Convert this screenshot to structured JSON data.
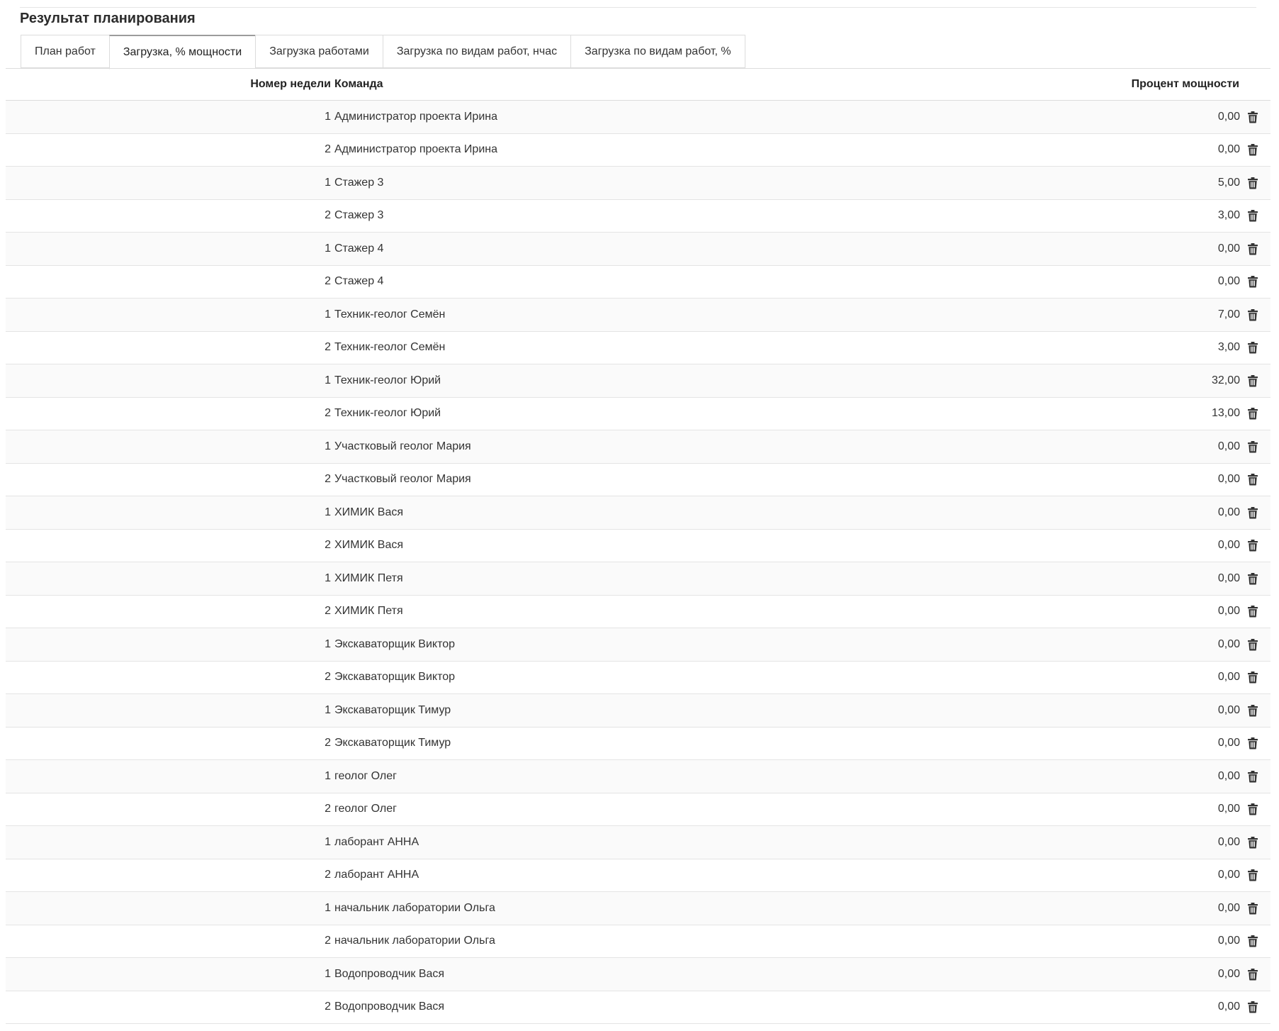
{
  "section": {
    "title": "Результат планирования"
  },
  "tabs": [
    {
      "label": "План работ",
      "active": false
    },
    {
      "label": "Загрузка, % мощности",
      "active": true
    },
    {
      "label": "Загрузка работами",
      "active": false
    },
    {
      "label": "Загрузка по видам работ, нчас",
      "active": false
    },
    {
      "label": "Загрузка по видам работ, %",
      "active": false
    }
  ],
  "table": {
    "headers": {
      "week": "Номер недели",
      "team": "Команда",
      "percent": "Процент мощности"
    },
    "row_action_icon": "trash-icon",
    "rows": [
      {
        "week": "1",
        "team": "Администратор проекта Ирина",
        "percent": "0,00"
      },
      {
        "week": "2",
        "team": "Администратор проекта Ирина",
        "percent": "0,00"
      },
      {
        "week": "1",
        "team": "Стажер 3",
        "percent": "5,00"
      },
      {
        "week": "2",
        "team": "Стажер 3",
        "percent": "3,00"
      },
      {
        "week": "1",
        "team": "Стажер 4",
        "percent": "0,00"
      },
      {
        "week": "2",
        "team": "Стажер 4",
        "percent": "0,00"
      },
      {
        "week": "1",
        "team": "Техник-геолог Семён",
        "percent": "7,00"
      },
      {
        "week": "2",
        "team": "Техник-геолог Семён",
        "percent": "3,00"
      },
      {
        "week": "1",
        "team": "Техник-геолог Юрий",
        "percent": "32,00"
      },
      {
        "week": "2",
        "team": "Техник-геолог Юрий",
        "percent": "13,00"
      },
      {
        "week": "1",
        "team": "Участковый геолог Мария",
        "percent": "0,00"
      },
      {
        "week": "2",
        "team": "Участковый геолог Мария",
        "percent": "0,00"
      },
      {
        "week": "1",
        "team": "ХИМИК Вася",
        "percent": "0,00"
      },
      {
        "week": "2",
        "team": "ХИМИК Вася",
        "percent": "0,00"
      },
      {
        "week": "1",
        "team": "ХИМИК Петя",
        "percent": "0,00"
      },
      {
        "week": "2",
        "team": "ХИМИК Петя",
        "percent": "0,00"
      },
      {
        "week": "1",
        "team": "Экскаваторщик Виктор",
        "percent": "0,00"
      },
      {
        "week": "2",
        "team": "Экскаваторщик Виктор",
        "percent": "0,00"
      },
      {
        "week": "1",
        "team": "Экскаваторщик Тимур",
        "percent": "0,00"
      },
      {
        "week": "2",
        "team": "Экскаваторщик Тимур",
        "percent": "0,00"
      },
      {
        "week": "1",
        "team": "геолог Олег",
        "percent": "0,00"
      },
      {
        "week": "2",
        "team": "геолог Олег",
        "percent": "0,00"
      },
      {
        "week": "1",
        "team": "лаборант АННА",
        "percent": "0,00"
      },
      {
        "week": "2",
        "team": "лаборант АННА",
        "percent": "0,00"
      },
      {
        "week": "1",
        "team": "начальник лаборатории Ольга",
        "percent": "0,00"
      },
      {
        "week": "2",
        "team": "начальник лаборатории Ольга",
        "percent": "0,00"
      },
      {
        "week": "1",
        "team": "Водопроводчик Вася",
        "percent": "0,00"
      },
      {
        "week": "2",
        "team": "Водопроводчик Вася",
        "percent": "0,00"
      }
    ]
  }
}
